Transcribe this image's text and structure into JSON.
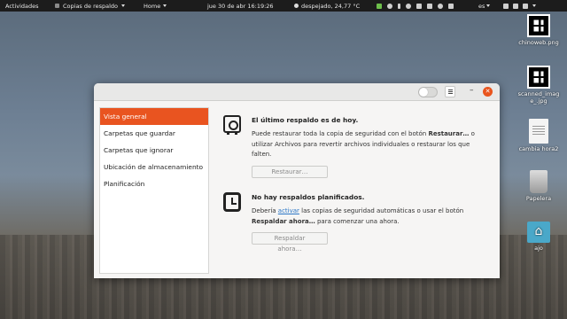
{
  "topbar": {
    "activities": "Actividades",
    "app_menu": "Copias de respaldo",
    "home_menu": "Home",
    "clock": "jue 30 de abr  16:19:26",
    "weather": "despejado, 24,77 °C",
    "language": "es"
  },
  "desktop": {
    "icons": [
      {
        "label": "chinoweb.png",
        "icon": "qr-image-icon"
      },
      {
        "label": "scanned_image_.jpg",
        "icon": "qr-image-icon"
      },
      {
        "label": "cambia hora2",
        "icon": "document-icon"
      },
      {
        "label": "Papelera",
        "icon": "trash-icon"
      },
      {
        "label": "ajo",
        "icon": "home-folder-icon"
      }
    ]
  },
  "dialog": {
    "sidebar": [
      "Vista general",
      "Carpetas que guardar",
      "Carpetas que ignorar",
      "Ubicación de almacenamiento",
      "Planificación"
    ],
    "sections": {
      "last_backup": {
        "title": "El último respaldo es de hoy.",
        "body_1": "Puede restaurar toda la copia de seguridad con el botón ",
        "body_bold": "Restaurar…",
        "body_2": " o utilizar Archivos para revertir archivos individuales o restaurar los que falten.",
        "button": "Restaurar…"
      },
      "schedule": {
        "title": "No hay respaldos planificados.",
        "body_1": "Debería ",
        "link": "activar",
        "body_2": " las copias de seguridad automáticas o usar el botón ",
        "body_bold": "Respaldar ahora…",
        "body_3": " para comenzar una ahora.",
        "button": "Respaldar ahora…"
      }
    },
    "colors": {
      "accent": "#e95420",
      "close": "#e9541d",
      "link": "#2a76c6"
    }
  }
}
